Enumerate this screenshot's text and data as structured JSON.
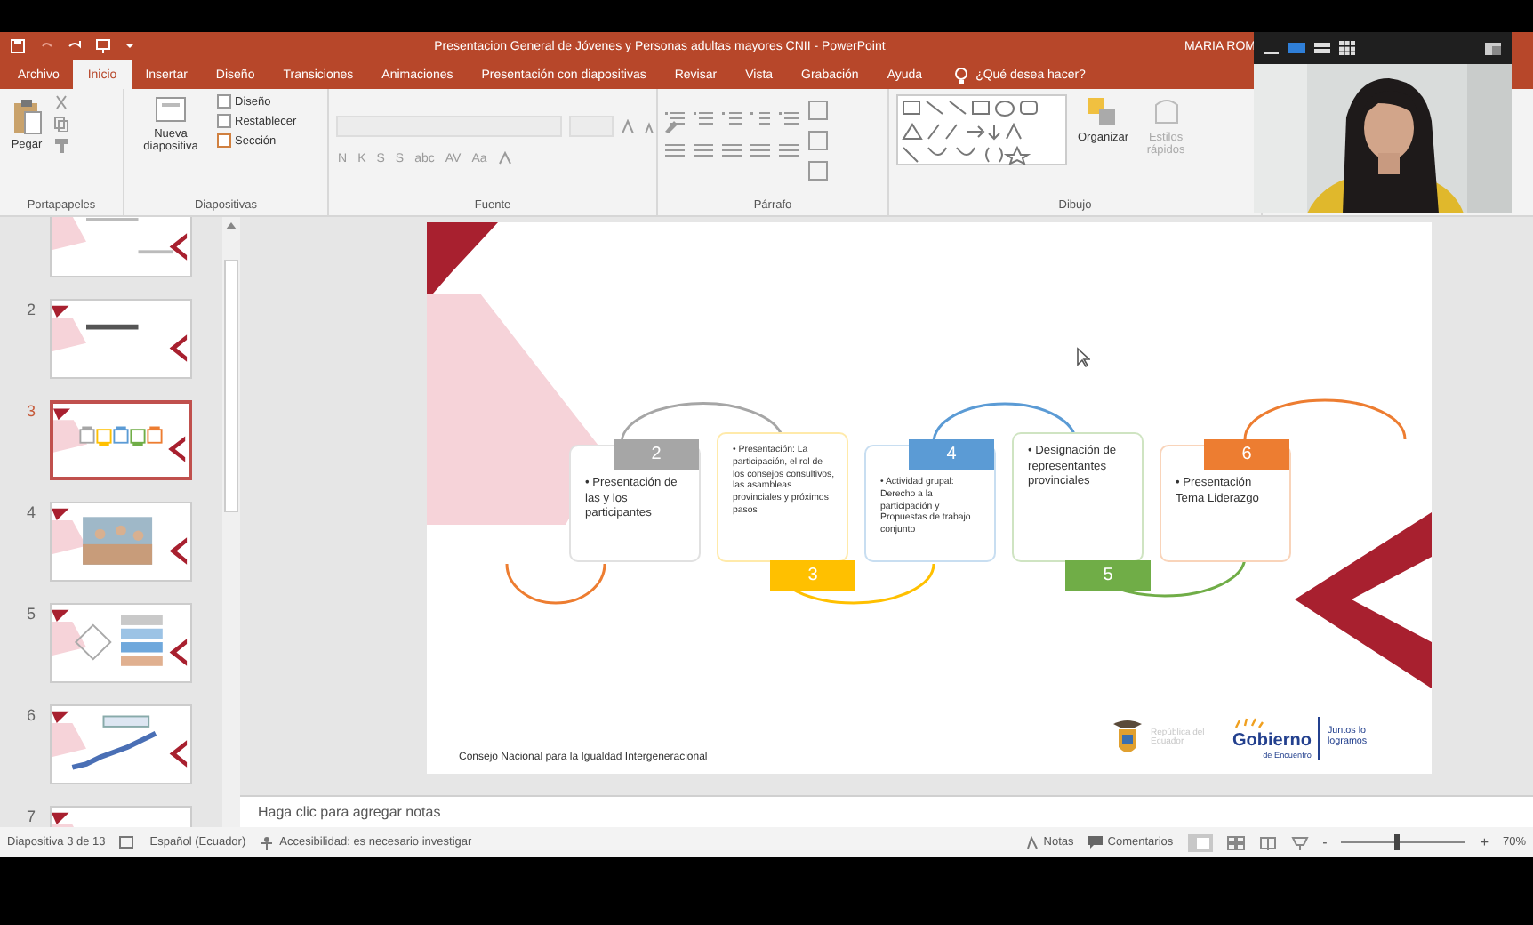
{
  "title_bar": {
    "title": "Presentacion General de Jóvenes y Personas adultas mayores CNII  -  PowerPoint",
    "user": "MARIA ROM"
  },
  "ribbon_tabs": [
    {
      "label": "Archivo",
      "selected": false
    },
    {
      "label": "Inicio",
      "selected": true
    },
    {
      "label": "Insertar",
      "selected": false
    },
    {
      "label": "Diseño",
      "selected": false
    },
    {
      "label": "Transiciones",
      "selected": false
    },
    {
      "label": "Animaciones",
      "selected": false
    },
    {
      "label": "Presentación con diapositivas",
      "selected": false
    },
    {
      "label": "Revisar",
      "selected": false
    },
    {
      "label": "Vista",
      "selected": false
    },
    {
      "label": "Grabación",
      "selected": false
    },
    {
      "label": "Ayuda",
      "selected": false
    }
  ],
  "tell_me": {
    "placeholder": "¿Qué desea hacer?"
  },
  "ribbon_groups": [
    {
      "kind": "clipboard",
      "label": "Portapapeles",
      "buttons": [
        "Pegar"
      ]
    },
    {
      "kind": "slides",
      "label": "Diapositivas",
      "buttons": [
        "Nueva diapositiva",
        "Diseño",
        "Restablecer",
        "Sección"
      ]
    },
    {
      "kind": "font",
      "label": "Fuente",
      "buttons": [
        "N",
        "K",
        "S",
        "S",
        "abc",
        "AV",
        "Aa"
      ]
    },
    {
      "kind": "paragraph",
      "label": "Párrafo"
    },
    {
      "kind": "drawing",
      "label": "Dibujo",
      "buttons": [
        "Organizar",
        "Estilos rápidos"
      ]
    }
  ],
  "thumbnails": [
    {
      "kind": "cover",
      "selected": false
    },
    {
      "number": "2",
      "kind": "title",
      "selected": false
    },
    {
      "number": "3",
      "kind": "diagram",
      "selected": true
    },
    {
      "number": "4",
      "selected": false
    },
    {
      "number": "5",
      "kind": "list",
      "selected": false
    },
    {
      "number": "6",
      "kind": "stairs",
      "selected": false
    },
    {
      "number": "7",
      "kind": "title",
      "selected": false
    }
  ],
  "slide": {
    "steps": [
      {
        "number": "2",
        "text": "• Presentación de las y los participantes",
        "color": "#a6a6a6",
        "kind": "top"
      },
      {
        "number": "3",
        "text": "• Presentación: La participación, el rol de los consejos consultivos, las asambleas provinciales y próximos pasos",
        "color": "#ffc000",
        "kind": "bottom"
      },
      {
        "number": "4",
        "text": "• Actividad grupal: Derecho a la participación y Propuestas de trabajo conjunto",
        "color": "#5b9bd5",
        "kind": "top"
      },
      {
        "number": "5",
        "text": "• Designación de representantes provinciales",
        "color": "#70ad47",
        "kind": "bottom"
      },
      {
        "number": "6",
        "text": "• Presentación Tema Liderazgo",
        "color": "#ed7d31",
        "kind": "top"
      }
    ],
    "footer": "Consejo Nacional para la Igualdad Intergeneracional",
    "logos": {
      "republic": "República del Ecuador",
      "brand": "Gobierno",
      "brand_sub": "de Encuentro",
      "slogan": "Juntos lo logramos"
    }
  },
  "notes": {
    "placeholder": "Haga clic para agregar notas"
  },
  "status_bar": {
    "slide_position": "Diapositiva 3 de 13",
    "language": "Español (Ecuador)",
    "accessibility": "Accesibilidad: es necesario investigar",
    "notes_button": "Notas",
    "comments_button": "Comentarios",
    "zoom_out": "-",
    "zoom_in": "+",
    "zoom": {
      "level": 0.45
    },
    "zoom_percent": "70%"
  }
}
